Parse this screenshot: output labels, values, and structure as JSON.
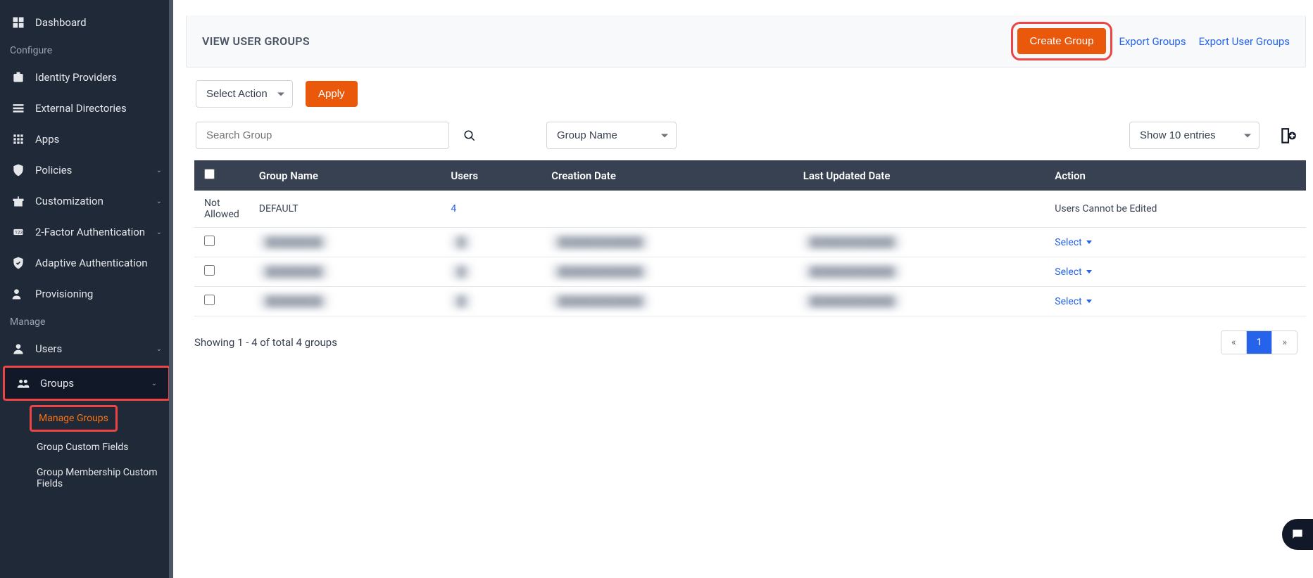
{
  "sidebar": {
    "dashboard": "Dashboard",
    "sections": {
      "configure": "Configure",
      "manage": "Manage"
    },
    "items": {
      "idp": "Identity Providers",
      "extdir": "External Directories",
      "apps": "Apps",
      "policies": "Policies",
      "custom": "Customization",
      "twofa": "2-Factor Authentication",
      "adaptive": "Adaptive Authentication",
      "provisioning": "Provisioning",
      "users": "Users",
      "groups": "Groups"
    },
    "groups_sub": {
      "manage": "Manage Groups",
      "customfields": "Group Custom Fields",
      "membership": "Group Membership Custom Fields"
    }
  },
  "header": {
    "title": "VIEW USER GROUPS",
    "create": "Create Group",
    "export_groups": "Export Groups",
    "export_user_groups": "Export User Groups"
  },
  "controls": {
    "select_action": "Select Action",
    "apply": "Apply",
    "search_placeholder": "Search Group",
    "filter_by": "Group Name",
    "entries": "Show 10 entries"
  },
  "table": {
    "columns": {
      "group_name": "Group Name",
      "users": "Users",
      "creation": "Creation Date",
      "updated": "Last Updated Date",
      "action": "Action"
    },
    "rows": [
      {
        "checkbox": "Not Allowed",
        "name": "DEFAULT",
        "users": "4",
        "creation": "",
        "updated": "",
        "action": "Users Cannot be Edited",
        "blurred": false,
        "link_users": true,
        "text_action": true
      },
      {
        "checkbox": "",
        "name": "blurred",
        "users": "blurred",
        "creation": "blurred",
        "updated": "blurred",
        "action": "Select",
        "blurred": true
      },
      {
        "checkbox": "",
        "name": "blurred",
        "users": "blurred",
        "creation": "blurred",
        "updated": "blurred",
        "action": "Select",
        "blurred": true
      },
      {
        "checkbox": "",
        "name": "blurred",
        "users": "blurred",
        "creation": "blurred",
        "updated": "blurred",
        "action": "Select",
        "blurred": true
      }
    ]
  },
  "footer": {
    "showing": "Showing 1 - 4 of total 4 groups",
    "prev": "«",
    "page": "1",
    "next": "»"
  }
}
